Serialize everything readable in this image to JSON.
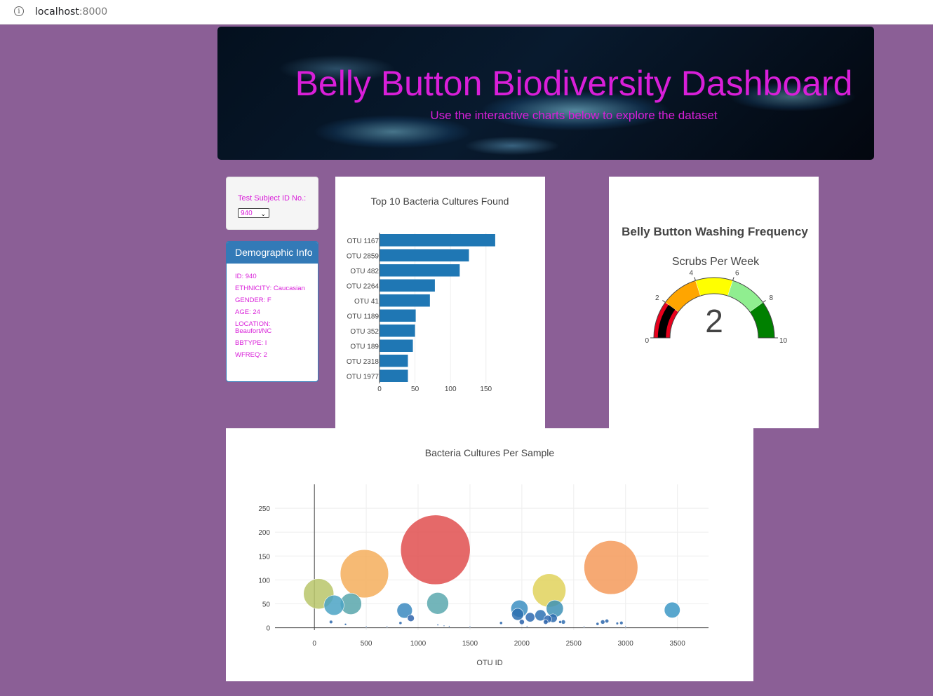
{
  "browser": {
    "url_host": "localhost",
    "url_port": ":8000"
  },
  "header": {
    "title": "Belly Button Biodiversity Dashboard",
    "subtitle": "Use the interactive charts below to explore the dataset"
  },
  "selector": {
    "label": "Test Subject ID No.:",
    "selected": "940"
  },
  "demographics": {
    "heading": "Demographic Info",
    "lines": [
      "ID: 940",
      "ETHNICITY: Caucasian",
      "GENDER: F",
      "AGE: 24",
      "LOCATION: Beaufort/NC",
      "BBTYPE: I",
      "WFREQ: 2"
    ]
  },
  "colors": {
    "background": "#8b5f96",
    "accent_text": "#d91fd9",
    "panel_header": "#337ab7",
    "bar": "#1f77b4"
  },
  "chart_data": [
    {
      "type": "bar",
      "orientation": "horizontal",
      "title": "Top 10 Bacteria Cultures Found",
      "categories": [
        "OTU 1167",
        "OTU 2859",
        "OTU 482",
        "OTU 2264",
        "OTU 41",
        "OTU 1189",
        "OTU 352",
        "OTU 189",
        "OTU 2318",
        "OTU 1977"
      ],
      "values": [
        163,
        126,
        113,
        78,
        71,
        51,
        50,
        47,
        40,
        40
      ],
      "xticks": [
        0,
        50,
        100,
        150
      ],
      "xlim": [
        0,
        170
      ],
      "grid": true
    },
    {
      "type": "gauge",
      "title": "Belly Button Washing Frequency",
      "subtitle": "Scrubs Per Week",
      "value": 2,
      "range": [
        0,
        10
      ],
      "ticks": [
        0,
        2,
        4,
        6,
        8,
        10
      ],
      "steps": [
        {
          "range": [
            0,
            2
          ],
          "color": "#e8001c"
        },
        {
          "range": [
            2,
            4
          ],
          "color": "#ffa500"
        },
        {
          "range": [
            4,
            6
          ],
          "color": "#ffff00"
        },
        {
          "range": [
            6,
            8
          ],
          "color": "#90ee90"
        },
        {
          "range": [
            8,
            10
          ],
          "color": "#008000"
        }
      ],
      "bar_color": "#000000"
    },
    {
      "type": "scatter",
      "subtype": "bubble",
      "title": "Bacteria Cultures Per Sample",
      "xlabel": "OTU ID",
      "xticks": [
        0,
        500,
        1000,
        1500,
        2000,
        2500,
        3000,
        3500
      ],
      "yticks": [
        0,
        50,
        100,
        150,
        200,
        250
      ],
      "xlim": [
        -380,
        3800
      ],
      "ylim": [
        -5,
        300
      ],
      "grid": true,
      "points": [
        {
          "x": 41,
          "y": 71,
          "size": 71,
          "color": "#b9c56a"
        },
        {
          "x": 189,
          "y": 47,
          "size": 47,
          "color": "#4ba3c4"
        },
        {
          "x": 352,
          "y": 50,
          "size": 50,
          "color": "#58a6ac"
        },
        {
          "x": 482,
          "y": 113,
          "size": 113,
          "color": "#f5ae5c"
        },
        {
          "x": 1167,
          "y": 163,
          "size": 163,
          "color": "#e14f4f"
        },
        {
          "x": 1189,
          "y": 51,
          "size": 51,
          "color": "#5aa8ae"
        },
        {
          "x": 2264,
          "y": 78,
          "size": 78,
          "color": "#e1d25c"
        },
        {
          "x": 2859,
          "y": 126,
          "size": 126,
          "color": "#f59a5a"
        },
        {
          "x": 1977,
          "y": 40,
          "size": 40,
          "color": "#3c8fc2"
        },
        {
          "x": 2318,
          "y": 40,
          "size": 40,
          "color": "#3e92b6"
        },
        {
          "x": 3450,
          "y": 37,
          "size": 37,
          "color": "#3c98c6"
        },
        {
          "x": 870,
          "y": 36,
          "size": 36,
          "color": "#3b89c0"
        },
        {
          "x": 1960,
          "y": 28,
          "size": 28,
          "color": "#2c6faf"
        },
        {
          "x": 2080,
          "y": 22,
          "size": 22,
          "color": "#2d6ab0"
        },
        {
          "x": 2180,
          "y": 26,
          "size": 26,
          "color": "#2e72b4"
        },
        {
          "x": 2250,
          "y": 18,
          "size": 18,
          "color": "#2f6ab1"
        },
        {
          "x": 2300,
          "y": 20,
          "size": 20,
          "color": "#2c6aae"
        },
        {
          "x": 930,
          "y": 20,
          "size": 16,
          "color": "#2f64ab"
        },
        {
          "x": 2000,
          "y": 12,
          "size": 12,
          "color": "#2c63aa"
        },
        {
          "x": 2230,
          "y": 12,
          "size": 11,
          "color": "#2c63aa"
        },
        {
          "x": 2400,
          "y": 12,
          "size": 10,
          "color": "#2f6db0"
        },
        {
          "x": 2780,
          "y": 12,
          "size": 10,
          "color": "#2c66ab"
        },
        {
          "x": 2820,
          "y": 14,
          "size": 9,
          "color": "#2c66ab"
        },
        {
          "x": 2960,
          "y": 10,
          "size": 8,
          "color": "#2c66ab"
        },
        {
          "x": 2920,
          "y": 9,
          "size": 6,
          "color": "#2c66ab"
        },
        {
          "x": 2730,
          "y": 8,
          "size": 7,
          "color": "#2c66ab"
        },
        {
          "x": 2370,
          "y": 12,
          "size": 7,
          "color": "#2c66ab"
        },
        {
          "x": 1800,
          "y": 10,
          "size": 7,
          "color": "#2c66ab"
        },
        {
          "x": 830,
          "y": 10,
          "size": 7,
          "color": "#2c66ab"
        },
        {
          "x": 160,
          "y": 12,
          "size": 8,
          "color": "#2c66ab"
        },
        {
          "x": 300,
          "y": 7,
          "size": 5,
          "color": "#2c66ab"
        },
        {
          "x": 1190,
          "y": 6,
          "size": 4,
          "color": "#2c66ab"
        },
        {
          "x": 1250,
          "y": 4,
          "size": 3,
          "color": "#2c66ab"
        },
        {
          "x": 1300,
          "y": 3,
          "size": 3,
          "color": "#2c66ab"
        },
        {
          "x": 1500,
          "y": 2,
          "size": 2,
          "color": "#2c66ab"
        },
        {
          "x": 2050,
          "y": 3,
          "size": 3,
          "color": "#2c66ab"
        },
        {
          "x": 2600,
          "y": 2,
          "size": 2,
          "color": "#2c66ab"
        },
        {
          "x": 3000,
          "y": 2,
          "size": 2,
          "color": "#2c66ab"
        },
        {
          "x": 500,
          "y": 2,
          "size": 2,
          "color": "#2c66ab"
        },
        {
          "x": 700,
          "y": 2,
          "size": 2,
          "color": "#2c66ab"
        }
      ]
    }
  ]
}
